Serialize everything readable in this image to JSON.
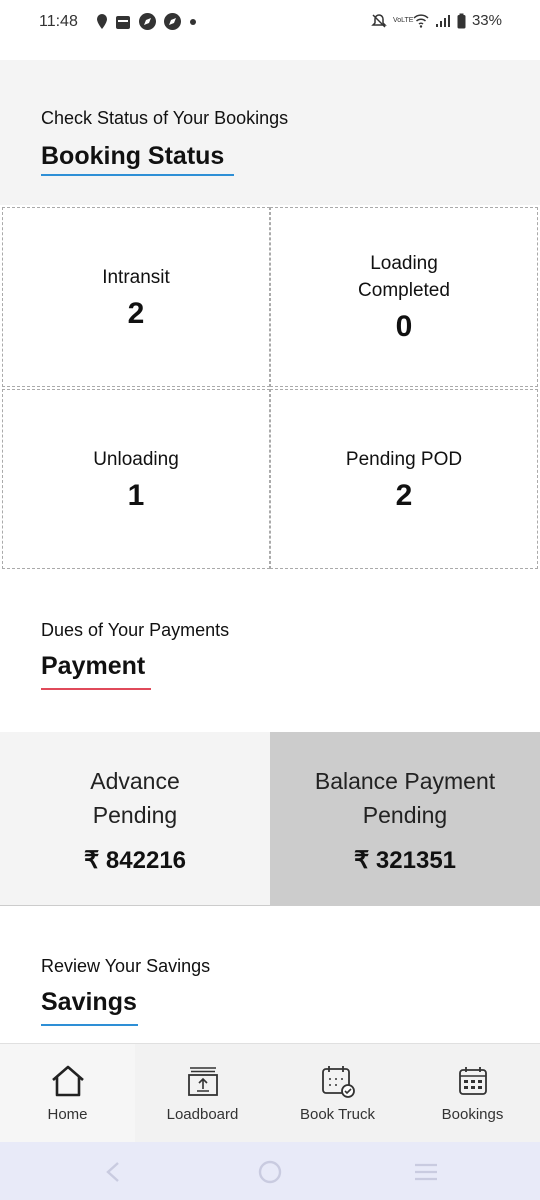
{
  "status_bar": {
    "time": "11:48",
    "battery": "33%",
    "network_label": "VoLTE"
  },
  "header": {
    "subtitle": "Check Status of Your Bookings",
    "title": "Booking Status"
  },
  "booking_status": [
    {
      "label": "Intransit",
      "value": "2"
    },
    {
      "label": "Loading Completed",
      "value": "0"
    },
    {
      "label": "Unloading",
      "value": "1"
    },
    {
      "label": "Pending POD",
      "value": "2"
    }
  ],
  "payment": {
    "subtitle": "Dues of Your Payments",
    "title": "Payment",
    "advance": {
      "label": "Advance Pending",
      "amount": "₹ 842216"
    },
    "balance": {
      "label": "Balance Payment Pending",
      "amount": "₹ 321351"
    }
  },
  "savings": {
    "subtitle": "Review Your Savings",
    "title": "Savings"
  },
  "bottom_nav": [
    {
      "label": "Home",
      "icon": "home-icon"
    },
    {
      "label": "Loadboard",
      "icon": "loadboard-icon"
    },
    {
      "label": "Book Truck",
      "icon": "book-truck-icon"
    },
    {
      "label": "Bookings",
      "icon": "bookings-icon"
    }
  ],
  "colors": {
    "accent_blue": "#2e8fd6",
    "accent_red": "#e04a5a",
    "balance_bg": "#cccccc",
    "advance_bg": "#f4f4f4"
  }
}
